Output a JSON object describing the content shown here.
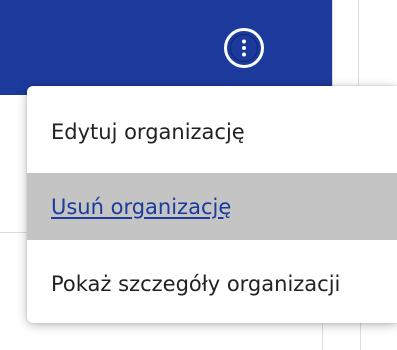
{
  "header": {
    "color": "#1b3a9c",
    "more_button_icon": "kebab-vertical-icon"
  },
  "menu": {
    "items": [
      {
        "label": "Edytuj organizację",
        "state": "normal"
      },
      {
        "label": "Usuń organizację",
        "state": "hover"
      },
      {
        "label": "Pokaż szczegóły organizacji",
        "state": "normal"
      }
    ],
    "hover_background": "#c4c4c4",
    "link_color": "#1b3a9c"
  }
}
